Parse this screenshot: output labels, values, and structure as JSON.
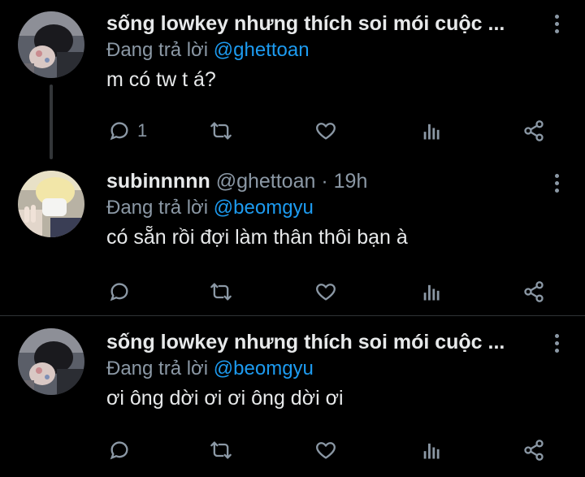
{
  "colors": {
    "background": "#000000",
    "name": "#e7e9ea",
    "muted": "#8b98a5",
    "mention": "#1d9bf0",
    "divider": "#2f3336"
  },
  "tweets": [
    {
      "display_name": "sống lowkey nhưng thích soi mói cuộc ...",
      "handle": "",
      "dot": "",
      "time": "",
      "reply_prefix": "Đang trả lời",
      "reply_to": "@ghettoan",
      "text": "m có tw t á?",
      "reply_count": "1",
      "retweet_count": "",
      "like_count": ""
    },
    {
      "display_name": "subinnnnn",
      "handle": "@ghettoan",
      "dot": "·",
      "time": "19h",
      "reply_prefix": "Đang trả lời",
      "reply_to": "@beomgyu",
      "text": "có sẵn rồi đợi làm thân thôi bạn à",
      "reply_count": "",
      "retweet_count": "",
      "like_count": ""
    },
    {
      "display_name": "sống lowkey nhưng thích soi mói cuộc ...",
      "handle": "",
      "dot": "",
      "time": "",
      "reply_prefix": "Đang trả lời",
      "reply_to": "@beomgyu",
      "text": "ơi ông dời ơi ơi ông dời ơi",
      "reply_count": "",
      "retweet_count": "",
      "like_count": ""
    }
  ],
  "icons": {
    "reply": "reply-bubble-icon",
    "retweet": "retweet-icon",
    "like": "heart-icon",
    "views": "views-bar-chart-icon",
    "share": "share-icon",
    "more": "more-vertical-icon"
  }
}
